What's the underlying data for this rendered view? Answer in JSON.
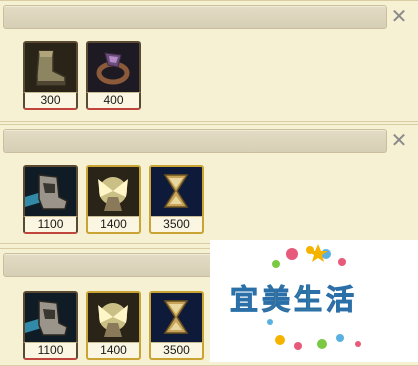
{
  "panels": [
    {
      "close_icon": "✕",
      "items": [
        {
          "icon": "boots-icon",
          "price": "300"
        },
        {
          "icon": "ring-icon",
          "price": "400"
        }
      ]
    },
    {
      "close_icon": "✕",
      "items": [
        {
          "icon": "armored-boots-icon",
          "price": "1100"
        },
        {
          "icon": "wings-icon",
          "price": "1400"
        },
        {
          "icon": "hourglass-icon",
          "price": "3500"
        }
      ]
    },
    {
      "close_icon": "✕",
      "items": [
        {
          "icon": "armored-boots-icon",
          "price": "1100"
        },
        {
          "icon": "wings-icon",
          "price": "1400"
        },
        {
          "icon": "hourglass-icon",
          "price": "3500"
        }
      ]
    }
  ],
  "watermark": {
    "chars": [
      "宜",
      "美",
      "生",
      "活"
    ]
  },
  "colors": {
    "background": "#f6f0d2",
    "gold_frame": "#c9a434",
    "dark_frame": "#5b4a32"
  }
}
